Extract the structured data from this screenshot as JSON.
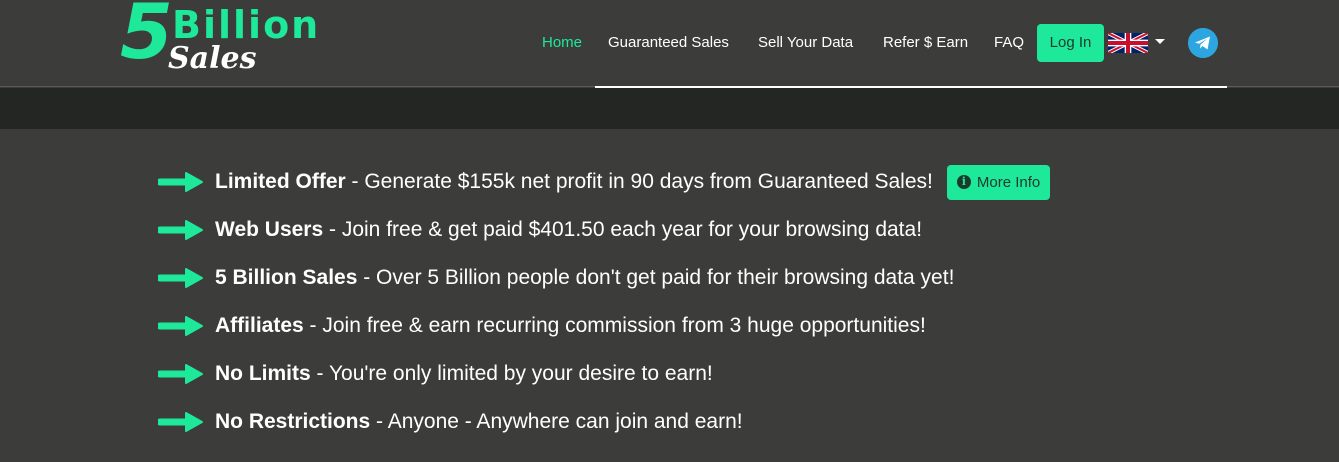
{
  "logo": {
    "five": "5",
    "billion": "Billion",
    "sales": "Sales"
  },
  "nav": {
    "items": [
      {
        "label": "Home",
        "active": true
      },
      {
        "label": "Guaranteed Sales",
        "active": false
      },
      {
        "label": "Sell Your Data",
        "active": false
      },
      {
        "label": "Refer $ Earn",
        "active": false
      },
      {
        "label": "FAQ",
        "active": false
      }
    ],
    "login_label": "Log In",
    "language_icon": "uk-flag-icon",
    "social_icon": "telegram-icon"
  },
  "colors": {
    "accent": "#1ee89a",
    "background": "#3c3d3a",
    "band": "#232622",
    "telegram": "#2ca5e0"
  },
  "features": [
    {
      "title": "Limited Offer",
      "text": " - Generate $155k net profit in 90 days from Guaranteed Sales!",
      "button": "More Info"
    },
    {
      "title": "Web Users",
      "text": " - Join free & get paid $401.50 each year for your browsing data!"
    },
    {
      "title": "5 Billion Sales",
      "text": " - Over 5 Billion people don't get paid for their browsing data yet!"
    },
    {
      "title": "Affiliates",
      "text": " - Join free & earn recurring commission from 3 huge opportunities!"
    },
    {
      "title": "No Limits",
      "text": " - You're only limited by your desire to earn!"
    },
    {
      "title": "No Restrictions",
      "text": " - Anyone - Anywhere can join and earn!"
    }
  ]
}
